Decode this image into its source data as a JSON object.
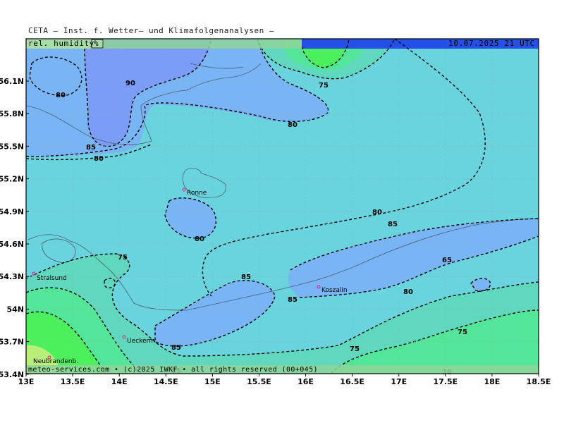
{
  "header": {
    "title": "CETA — Inst. f. Wetter— und Klimafolgenanalysen —",
    "parameter": "rel. humidity",
    "unit": "%",
    "valid_time": "10.07.2025 21 UTC"
  },
  "footer": {
    "credit": "meteo-services.com • (c)2025 IWKF • all rights reserved (00+045)"
  },
  "axes": {
    "x_ticks": [
      "13E",
      "13.5E",
      "14E",
      "14.5E",
      "15E",
      "15.5E",
      "16E",
      "16.5E",
      "17E",
      "17.5E",
      "18E",
      "18.5E"
    ],
    "y_ticks": [
      "56.1N",
      "55.8N",
      "55.5N",
      "55.2N",
      "54.9N",
      "54.6N",
      "54.3N",
      "54N",
      "53.7N",
      "53.4N"
    ]
  },
  "cities": [
    {
      "name": "Ronne"
    },
    {
      "name": "Stralsund"
    },
    {
      "name": "Koszalin"
    },
    {
      "name": "Ueckerm."
    },
    {
      "name": "Neubrandenb."
    }
  ],
  "contour_labels": [
    "90",
    "80",
    "85",
    "80",
    "80",
    "75",
    "80",
    "80",
    "75",
    "85",
    "85",
    "85",
    "80",
    "85",
    "65",
    "75",
    "75",
    "85",
    "70",
    "80"
  ],
  "colors": {
    "ge90": "#7b9cf7",
    "r85_90": "#79b4f5",
    "r80_85": "#6ad4de",
    "r75_80": "#5fd8bd",
    "r70_75": "#53e698",
    "r65_70": "#4cf05c",
    "r60_65": "#7fdc5a",
    "r55_60": "#b7ef79",
    "land_outline": "#4a5e70",
    "isoline": "#000000",
    "city_marker": "#d0208a"
  }
}
